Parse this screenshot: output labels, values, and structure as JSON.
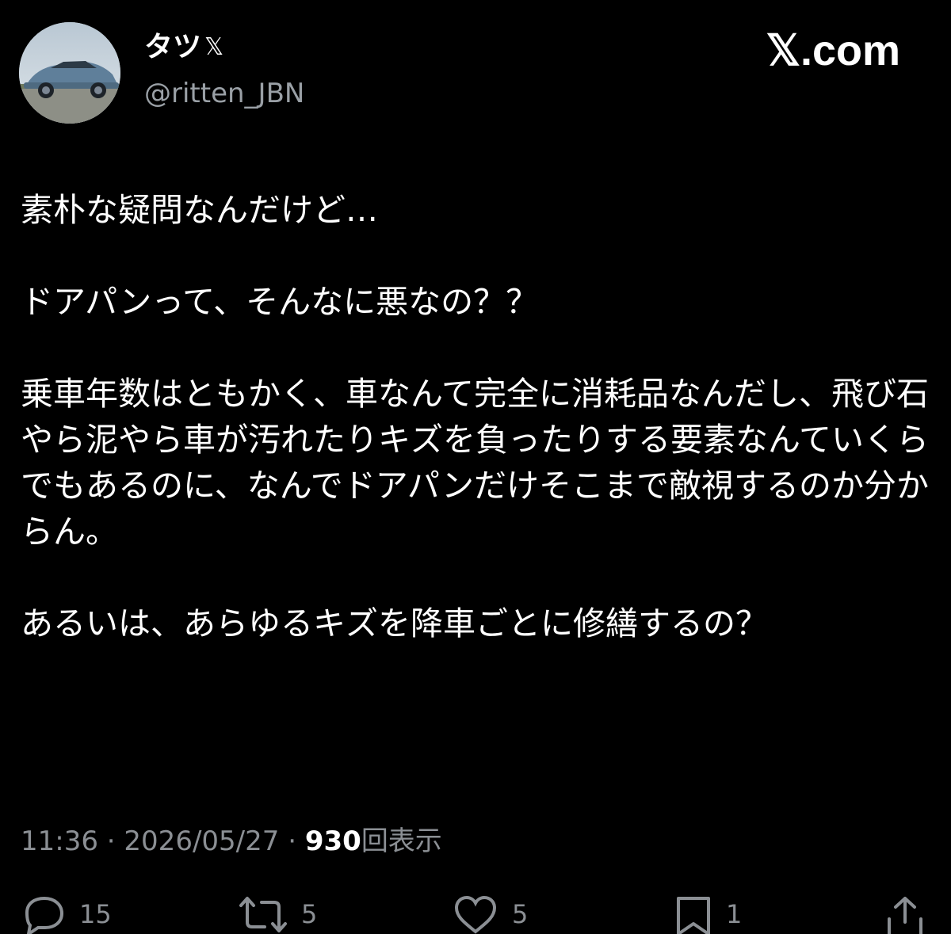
{
  "author": {
    "display_name": "タツ",
    "badge_icon": "x-badge-icon",
    "badge_glyph": "𝕏",
    "handle": "@ritten_JBN",
    "avatar": "car-photo-avatar"
  },
  "site_logo": "𝕏.com",
  "tweet": {
    "paragraphs": [
      "素朴な疑問なんだけど…",
      "ドアパンって、そんなに悪なの？？",
      "乗車年数はともかく、車なんて完全に消耗品なんだし、飛び石やら泥やら車が汚れたりキズを負ったりする要素なんていくらでもあるのに、なんでドアパンだけそこまで敵視するのか分からん。",
      "あるいは、あらゆるキズを降車ごとに修繕するの？"
    ]
  },
  "meta": {
    "time": "11:36",
    "separator": "·",
    "date": "2026/05/27",
    "views_count": "930",
    "views_label": "回表示"
  },
  "actions": {
    "reply": {
      "icon": "reply-icon",
      "count": "15"
    },
    "repost": {
      "icon": "repost-icon",
      "count": "5"
    },
    "like": {
      "icon": "heart-icon",
      "count": "5"
    },
    "bookmark": {
      "icon": "bookmark-icon",
      "count": "1"
    },
    "share": {
      "icon": "share-icon"
    }
  },
  "colors": {
    "background": "#000000",
    "text": "#ffffff",
    "muted": "#8b8f94"
  }
}
